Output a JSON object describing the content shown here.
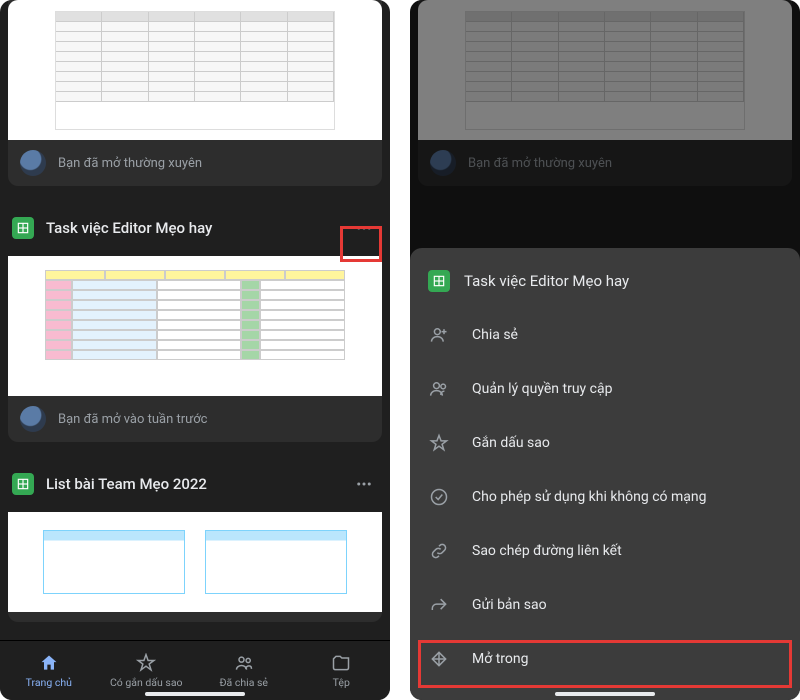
{
  "left": {
    "cards": [
      {
        "meta": "Bạn đã mở thường xuyên"
      },
      {
        "title": "Task việc Editor Mẹo hay",
        "meta": "Bạn đã mở vào tuần trước"
      },
      {
        "title": "List bài Team Mẹo 2022"
      }
    ],
    "nav": {
      "home": "Trang chủ",
      "starred": "Có gắn dấu sao",
      "shared": "Đã chia sẻ",
      "files": "Tệp"
    }
  },
  "right": {
    "dim_card_meta": "Bạn đã mở thường xuyên",
    "sheet": {
      "title": "Task việc Editor Mẹo hay",
      "items": [
        {
          "icon": "person-plus-icon",
          "label": "Chia sẻ"
        },
        {
          "icon": "people-icon",
          "label": "Quản lý quyền truy cập"
        },
        {
          "icon": "star-icon",
          "label": "Gắn dấu sao"
        },
        {
          "icon": "offline-icon",
          "label": "Cho phép sử dụng khi không có mạng"
        },
        {
          "icon": "link-icon",
          "label": "Sao chép đường liên kết"
        },
        {
          "icon": "send-copy-icon",
          "label": "Gửi bản sao"
        },
        {
          "icon": "open-in-icon",
          "label": "Mở trong"
        }
      ]
    }
  }
}
